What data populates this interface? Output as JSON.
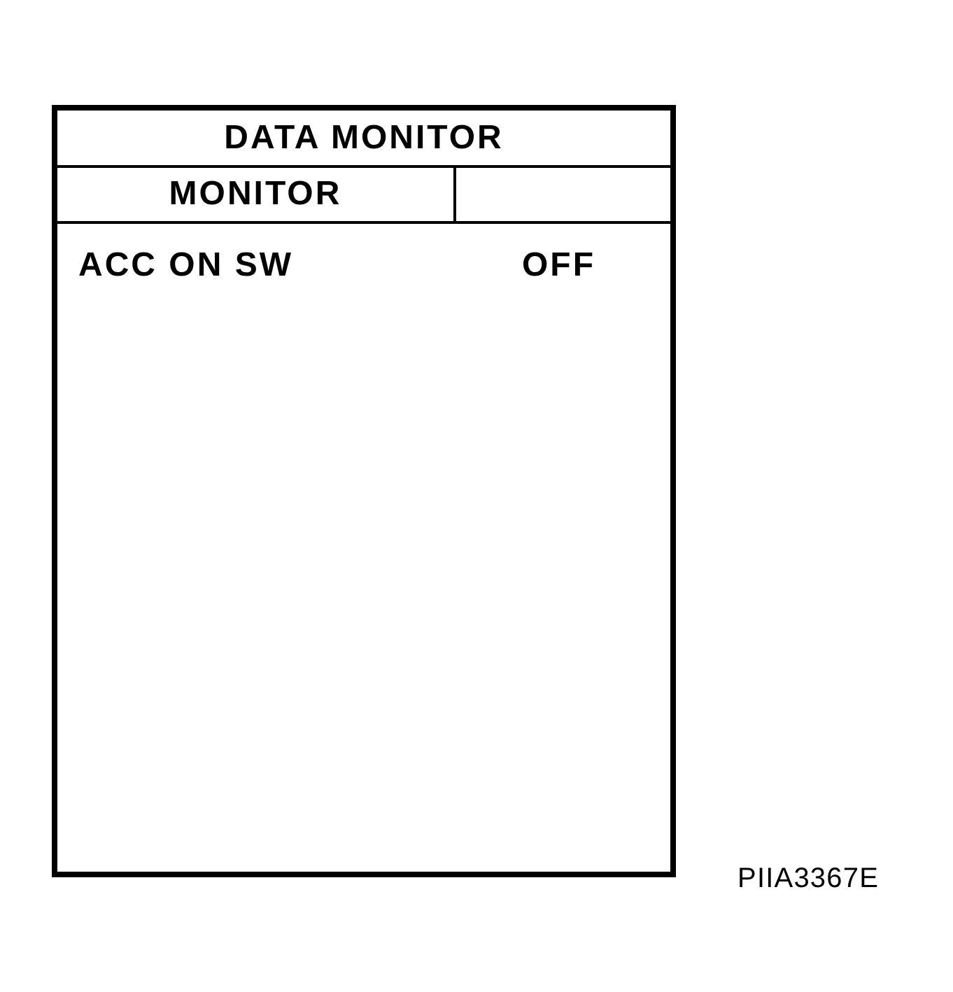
{
  "panel": {
    "title": "DATA MONITOR",
    "header": {
      "column_1": "MONITOR"
    }
  },
  "rows": [
    {
      "item": "ACC ON SW",
      "value": "OFF"
    }
  ],
  "figure_code": "PIIA3367E"
}
